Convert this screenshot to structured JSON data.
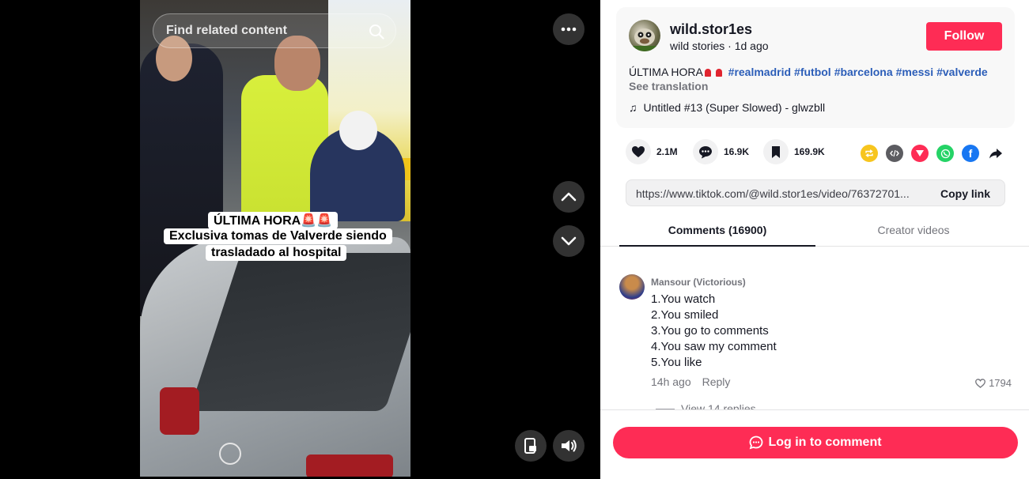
{
  "video": {
    "search_placeholder": "Find related content",
    "caption_line1": "ÚLTIMA HORA🚨🚨",
    "caption_line2": "Exclusiva tomas de Valverde siendo",
    "caption_line3": "trasladado al hospital"
  },
  "author": {
    "username": "wild.stor1es",
    "display_name": "wild stories",
    "posted": "1d ago",
    "follow_label": "Follow"
  },
  "description": {
    "text": "ÚLTIMA HORA",
    "hashtags": [
      "#realmadrid",
      "#futbol",
      "#barcelona",
      "#messi",
      "#valverde"
    ],
    "see_translation": "See translation"
  },
  "music": {
    "title": "Untitled #13 (Super Slowed) - glwzbll"
  },
  "stats": {
    "likes": "2.1M",
    "comments": "16.9K",
    "saves": "169.9K"
  },
  "share": {
    "icons": [
      "repost-icon",
      "embed-icon",
      "send-icon",
      "whatsapp-icon",
      "facebook-icon",
      "share-arrow-icon"
    ],
    "link": "https://www.tiktok.com/@wild.stor1es/video/76372701...",
    "copy_label": "Copy link"
  },
  "tabs": {
    "comments": "Comments (16900)",
    "creator_videos": "Creator videos"
  },
  "comment": {
    "author": "Mansour (Victorious)",
    "lines": [
      "1.You watch",
      "2.You smiled",
      "3.You go to comments",
      "4.You saw my comment",
      "5.You like"
    ],
    "time": "14h ago",
    "reply_label": "Reply",
    "likes": "1794",
    "view_replies": "View 14 replies"
  },
  "login": {
    "label": "Log in to comment"
  },
  "colors": {
    "accent": "#fe2c55",
    "hashtag": "#2b5db8"
  }
}
